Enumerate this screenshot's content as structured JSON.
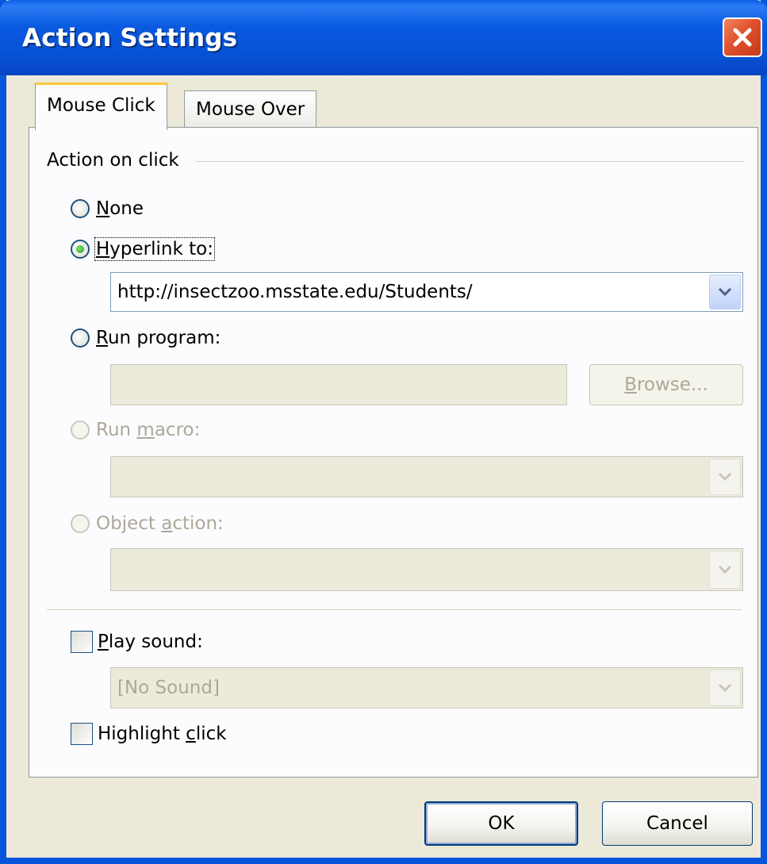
{
  "window": {
    "title": "Action Settings"
  },
  "tabs": [
    {
      "label": "Mouse Click",
      "active": true
    },
    {
      "label": "Mouse Over",
      "active": false
    }
  ],
  "group": {
    "label": "Action on click"
  },
  "options": {
    "none": {
      "label_u": "N",
      "label_rest": "one"
    },
    "hyperlink": {
      "label_u": "H",
      "label_rest": "yperlink to:",
      "value": "http://insectzoo.msstate.edu/Students/"
    },
    "run_program": {
      "label_u": "R",
      "label_rest": "un program:",
      "value": "",
      "browse_u": "B",
      "browse_rest": "rowse..."
    },
    "run_macro": {
      "label_pre": "Run ",
      "label_u": "m",
      "label_rest": "acro:",
      "value": ""
    },
    "object_action": {
      "label_pre": "Object ",
      "label_u": "a",
      "label_rest": "ction:",
      "value": ""
    }
  },
  "play_sound": {
    "label_u": "P",
    "label_rest": "lay sound:",
    "value": "[No Sound]",
    "checked": false
  },
  "highlight_click": {
    "label_pre": "Highlight ",
    "label_u": "c",
    "label_rest": "lick",
    "checked": false
  },
  "buttons": {
    "ok": "OK",
    "cancel": "Cancel"
  }
}
